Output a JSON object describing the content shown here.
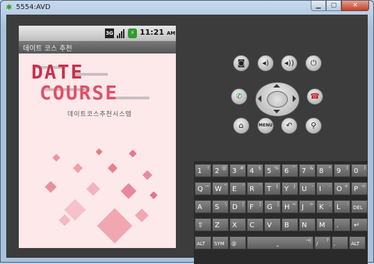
{
  "window": {
    "title": "5554:AVD",
    "controls": [
      "minimize",
      "maximize",
      "close"
    ]
  },
  "device": {
    "status_bar": {
      "network": "3G",
      "time": "11:21",
      "ampm": "AM"
    },
    "app_title": "데이트 코스 추천",
    "logo": {
      "line1": "DATE",
      "line2": "COURSE",
      "subtitle": "데이트코스추천시스템"
    }
  },
  "controls": {
    "buttons": [
      "camera-icon",
      "volume-down-icon",
      "volume-up-icon",
      "power-icon",
      "call-icon",
      "end-call-icon",
      "home-icon",
      "menu-button",
      "back-icon",
      "search-icon"
    ],
    "menu_label": "MENU"
  },
  "keyboard": {
    "row1": [
      {
        "k": "1",
        "a": "!"
      },
      {
        "k": "2",
        "a": "@"
      },
      {
        "k": "3",
        "a": "#"
      },
      {
        "k": "4",
        "a": "$"
      },
      {
        "k": "5",
        "a": "%"
      },
      {
        "k": "6",
        "a": "^"
      },
      {
        "k": "7",
        "a": "&"
      },
      {
        "k": "8",
        "a": "*"
      },
      {
        "k": "9",
        "a": "("
      },
      {
        "k": "0",
        "a": ")"
      }
    ],
    "row2": [
      {
        "k": "Q",
        "a": "~"
      },
      {
        "k": "W",
        "a": "\""
      },
      {
        "k": "E",
        "a": "'"
      },
      {
        "k": "R",
        "a": "`"
      },
      {
        "k": "T",
        "a": "{"
      },
      {
        "k": "Y",
        "a": "}"
      },
      {
        "k": "U",
        "a": "-"
      },
      {
        "k": "I",
        "a": "-"
      },
      {
        "k": "O",
        "a": "+"
      },
      {
        "k": "P",
        "a": "="
      }
    ],
    "row3": [
      {
        "k": "A",
        "a": ""
      },
      {
        "k": "S",
        "a": "\\"
      },
      {
        "k": "D",
        "a": "|"
      },
      {
        "k": "F",
        "a": "["
      },
      {
        "k": "G",
        "a": "]"
      },
      {
        "k": "H",
        "a": "<"
      },
      {
        "k": "J",
        "a": ">"
      },
      {
        "k": "K",
        "a": ";"
      },
      {
        "k": "L",
        "a": ":"
      },
      {
        "k": "DEL",
        "a": ""
      }
    ],
    "row4": [
      {
        "k": "⇧",
        "a": ""
      },
      {
        "k": "Z",
        "a": ""
      },
      {
        "k": "X",
        "a": ""
      },
      {
        "k": "C",
        "a": ""
      },
      {
        "k": "V",
        "a": ""
      },
      {
        "k": "B",
        "a": ""
      },
      {
        "k": "N",
        "a": ""
      },
      {
        "k": "M",
        "a": ""
      },
      {
        "k": ".",
        "a": ""
      },
      {
        "k": "↵",
        "a": ""
      }
    ],
    "row5": [
      {
        "k": "ALT",
        "a": ""
      },
      {
        "k": "SYM",
        "a": ""
      },
      {
        "k": "@",
        "a": ""
      },
      {
        "k": "⎵",
        "a": "→|"
      },
      {
        "k": "/",
        "a": "?"
      },
      {
        "k": ",",
        "a": ""
      },
      {
        "k": "ALT",
        "a": ""
      }
    ]
  },
  "colors": {
    "accent": "#d63b57",
    "background": "#fde8ea",
    "chrome": "#3c3c3c"
  }
}
